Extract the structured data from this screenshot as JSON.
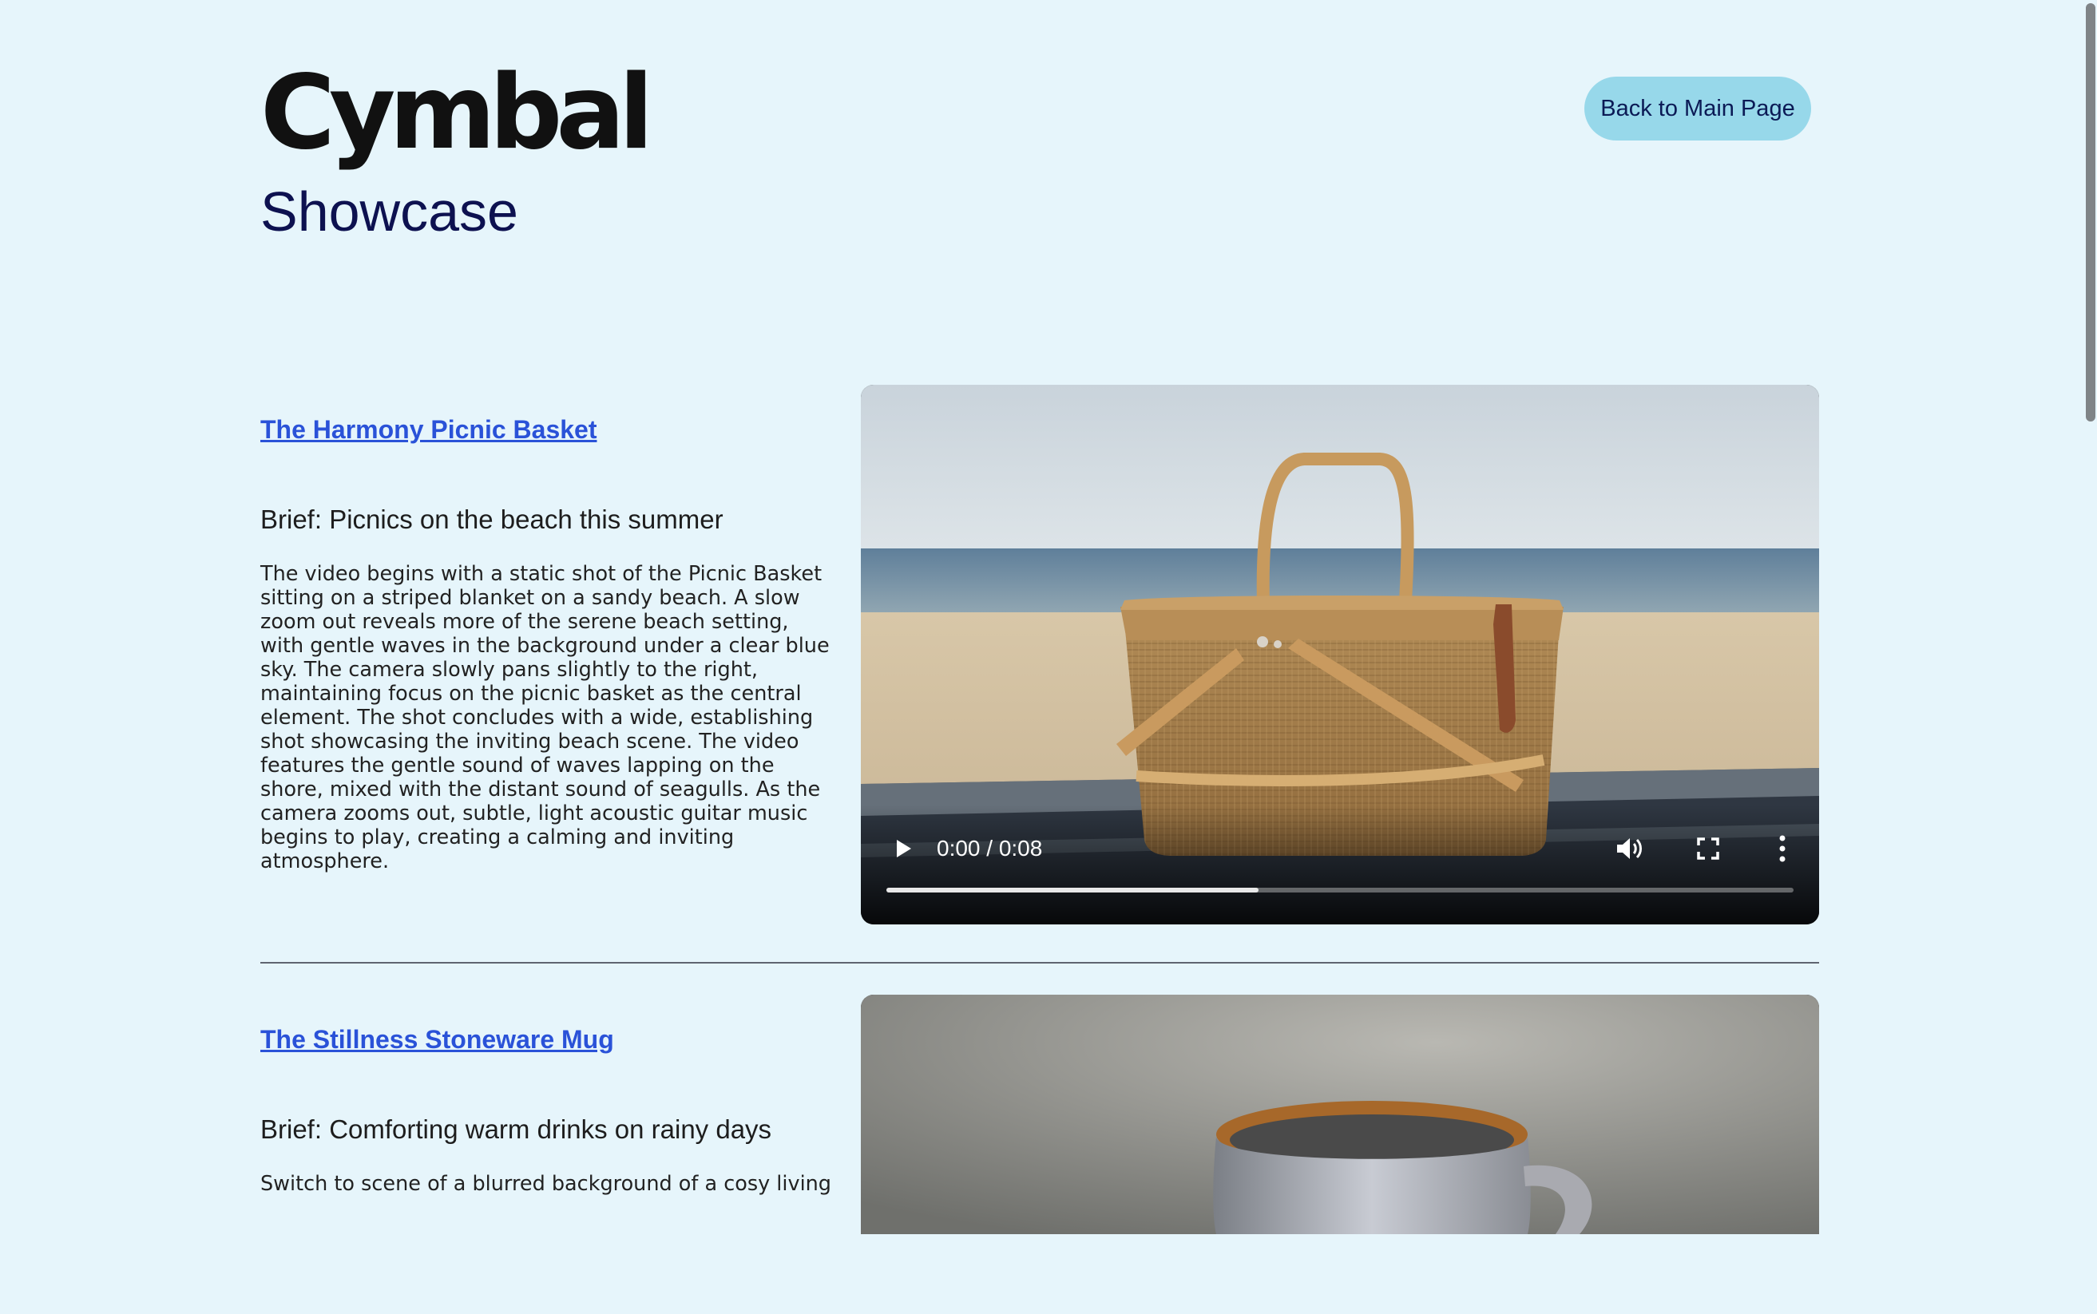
{
  "header": {
    "logo_text": "Cymbal",
    "back_button_label": "Back to Main Page"
  },
  "page_title": "Showcase",
  "items": [
    {
      "title": "The Harmony Picnic Basket",
      "brief": "Brief: Picnics on the beach this summer",
      "description": "The video begins with a static shot of the Picnic Basket sitting on a striped blanket on a sandy beach. A slow zoom out reveals more of the serene beach setting, with gentle waves in the background under a clear blue sky. The camera slowly pans slightly to the right, maintaining focus on the picnic basket as the central element. The shot concludes with a wide, establishing shot showcasing the inviting beach scene. The video features the gentle sound of waves lapping on the shore, mixed with the distant sound of seagulls. As the camera zooms out, subtle, light acoustic guitar music begins to play, creating a calming and inviting atmosphere.",
      "video": {
        "time": "0:00 / 0:08",
        "progress": 0.41
      }
    },
    {
      "title": "The Stillness Stoneware Mug",
      "brief": "Brief: Comforting warm drinks on rainy days",
      "description": "Switch to scene of a blurred background of a cosy living"
    }
  ],
  "icons": {
    "play": "play-icon",
    "volume": "volume-icon",
    "fullscreen": "fullscreen-icon",
    "more": "more-vertical-icon"
  },
  "colors": {
    "background": "#e6f5fb",
    "link": "#2a52d8",
    "title": "#0d1150",
    "button": "#97d8ea"
  }
}
